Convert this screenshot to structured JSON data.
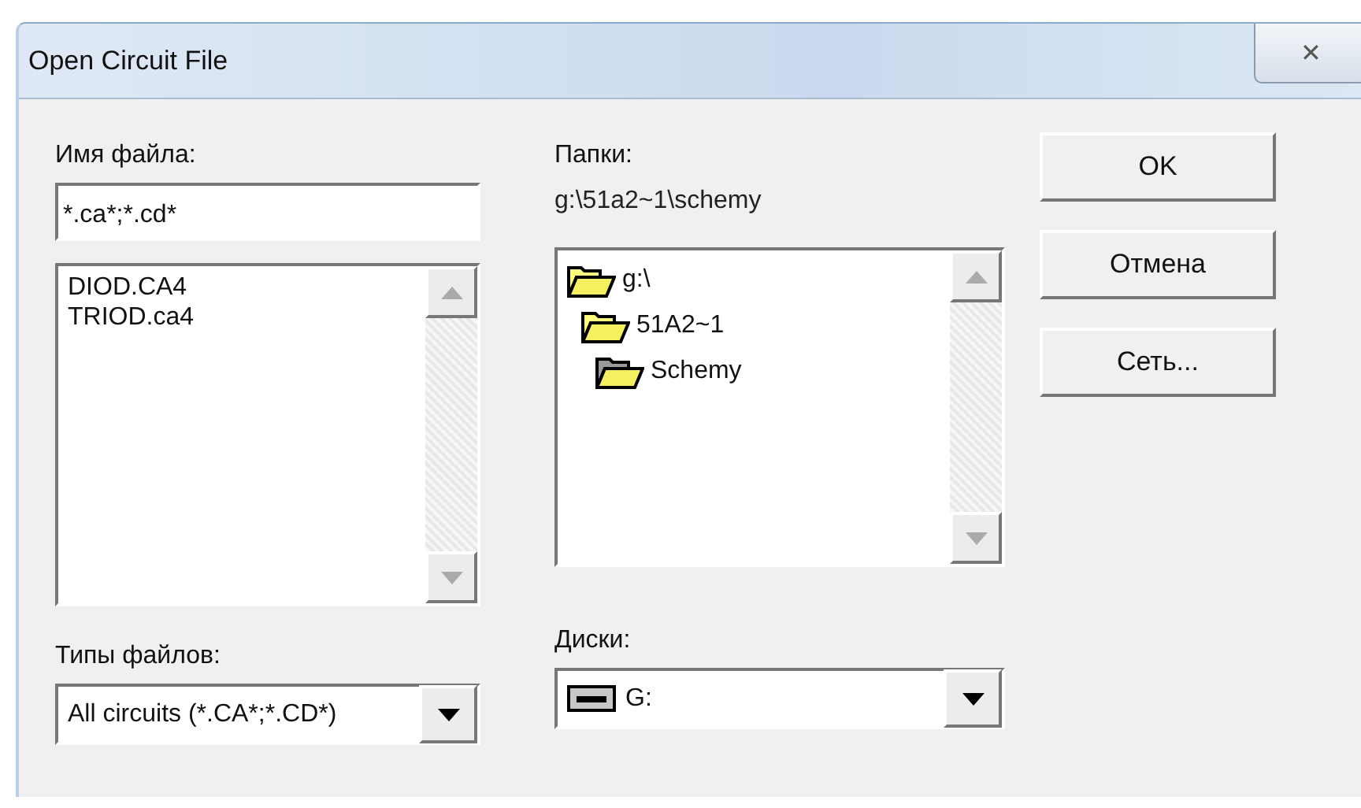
{
  "window": {
    "title": "Open Circuit File",
    "close": "✕"
  },
  "file_name": {
    "label": "Имя файла:",
    "value": "*.ca*;*.cd*"
  },
  "files": [
    {
      "name": "DIOD.CA4",
      "selected": false
    },
    {
      "name": "TRIOD.ca4",
      "selected": false
    }
  ],
  "folders": {
    "label": "Папки:",
    "path": "g:\\51a2~1\\schemy",
    "tree": [
      {
        "name": "g:\\",
        "current": false,
        "children": [
          {
            "name": "51A2~1",
            "current": false,
            "children": [
              {
                "name": "Schemy",
                "current": true
              }
            ]
          }
        ]
      }
    ]
  },
  "file_types": {
    "label": "Типы файлов:",
    "value": "All circuits (*.CA*;*.CD*)"
  },
  "drives": {
    "label": "Диски:",
    "value": "G:"
  },
  "buttons": [
    "OK",
    "Отмена",
    "Сеть..."
  ]
}
